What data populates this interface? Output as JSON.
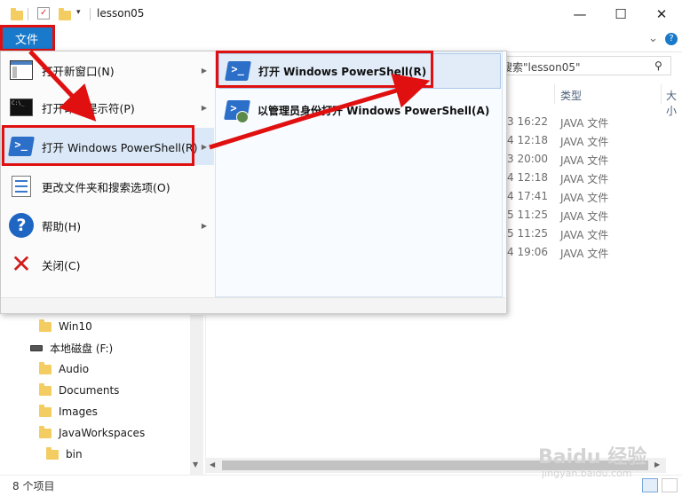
{
  "window": {
    "title": "lesson05",
    "minimize_glyph": "—",
    "maximize_glyph": "☐",
    "close_glyph": "✕"
  },
  "ribbon": {
    "file_tab": "文件",
    "expand_glyph": "⌄",
    "help_glyph": "?"
  },
  "search": {
    "placeholder": "搜索\"lesson05\""
  },
  "columns": {
    "type": "类型",
    "size": "大小"
  },
  "files": [
    {
      "date": "3 16:22",
      "type": "JAVA 文件"
    },
    {
      "date": "4 12:18",
      "type": "JAVA 文件"
    },
    {
      "date": "3 20:00",
      "type": "JAVA 文件"
    },
    {
      "date": "4 12:18",
      "type": "JAVA 文件"
    },
    {
      "date": "4 17:41",
      "type": "JAVA 文件"
    },
    {
      "date": "5 11:25",
      "type": "JAVA 文件"
    },
    {
      "date": "5 11:25",
      "type": "JAVA 文件"
    },
    {
      "date": "4 19:06",
      "type": "JAVA 文件"
    }
  ],
  "nav": [
    "Win10",
    "本地磁盘 (F:)",
    "Audio",
    "Documents",
    "Images",
    "JavaWorkspaces",
    "bin"
  ],
  "status": {
    "count": "8 个项目"
  },
  "file_menu": {
    "left": [
      {
        "label": "打开新窗口(N)",
        "icon": "new-window-icon"
      },
      {
        "label": "打开命令提示符(P)",
        "icon": "cmd-icon"
      },
      {
        "label": "打开 Windows PowerShell(R)",
        "icon": "powershell-icon"
      },
      {
        "label": "更改文件夹和搜索选项(O)",
        "icon": "options-icon"
      },
      {
        "label": "帮助(H)",
        "icon": "help-icon"
      },
      {
        "label": "关闭(C)",
        "icon": "close-x-icon"
      }
    ],
    "right": [
      {
        "label": "打开 Windows PowerShell(R)",
        "icon": "powershell-icon"
      },
      {
        "label": "以管理员身份打开 Windows PowerShell(A)",
        "icon": "powershell-admin-icon"
      }
    ]
  },
  "watermark": {
    "text": "Baidu 经验",
    "url": "jingyan.baidu.com"
  },
  "colors": {
    "accent": "#1979ca",
    "annotation": "#e01010"
  }
}
